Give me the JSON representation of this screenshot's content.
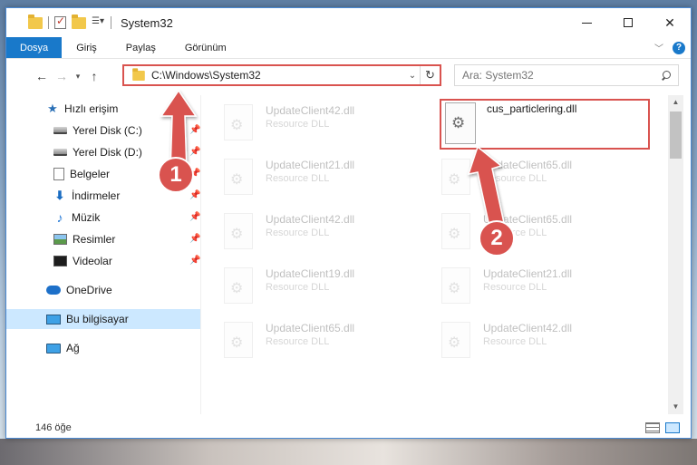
{
  "window": {
    "title": "System32"
  },
  "ribbon": {
    "tabs": [
      {
        "label": "Dosya"
      },
      {
        "label": "Giriş"
      },
      {
        "label": "Paylaş"
      },
      {
        "label": "Görünüm"
      }
    ],
    "help_label": "?"
  },
  "address_bar": {
    "path": "C:\\Windows\\System32"
  },
  "search": {
    "placeholder": "Ara: System32"
  },
  "sidebar": {
    "items": [
      {
        "label": "Hızlı erişim",
        "icon": "star-icon"
      },
      {
        "label": "Yerel Disk (C:)",
        "icon": "drive-icon",
        "pinned": true
      },
      {
        "label": "Yerel Disk (D:)",
        "icon": "drive-icon",
        "pinned": true
      },
      {
        "label": "Belgeler",
        "icon": "documents-icon",
        "pinned": true
      },
      {
        "label": "İndirmeler",
        "icon": "downloads-icon",
        "pinned": true
      },
      {
        "label": "Müzik",
        "icon": "music-icon",
        "pinned": true
      },
      {
        "label": "Resimler",
        "icon": "pictures-icon",
        "pinned": true
      },
      {
        "label": "Videolar",
        "icon": "videos-icon",
        "pinned": true
      },
      {
        "label": "OneDrive",
        "icon": "onedrive-icon"
      },
      {
        "label": "Bu bilgisayar",
        "icon": "this-pc-icon",
        "selected": true
      },
      {
        "label": "Ağ",
        "icon": "network-icon"
      }
    ]
  },
  "files": {
    "left_column": [
      {
        "name": "UpdateClient42.dll",
        "type": "Resource DLL"
      },
      {
        "name": "UpdateClient21.dll",
        "type": "Resource DLL"
      },
      {
        "name": "UpdateClient42.dll",
        "type": "Resource DLL"
      },
      {
        "name": "UpdateClient19.dll",
        "type": "Resource DLL"
      },
      {
        "name": "UpdateClient65.dll",
        "type": "Resource DLL"
      }
    ],
    "right_column": [
      {
        "name": "cus_particlering.dll",
        "type": ""
      },
      {
        "name": "UpdateClient65.dll",
        "type": "Resource DLL"
      },
      {
        "name": "UpdateClient65.dll",
        "type": "Resource DLL"
      },
      {
        "name": "UpdateClient21.dll",
        "type": "Resource DLL"
      },
      {
        "name": "UpdateClient42.dll",
        "type": "Resource DLL"
      }
    ]
  },
  "status": {
    "item_count": "146 öğe"
  },
  "annotations": {
    "step1": "1",
    "step2": "2",
    "color": "#d9534f"
  }
}
